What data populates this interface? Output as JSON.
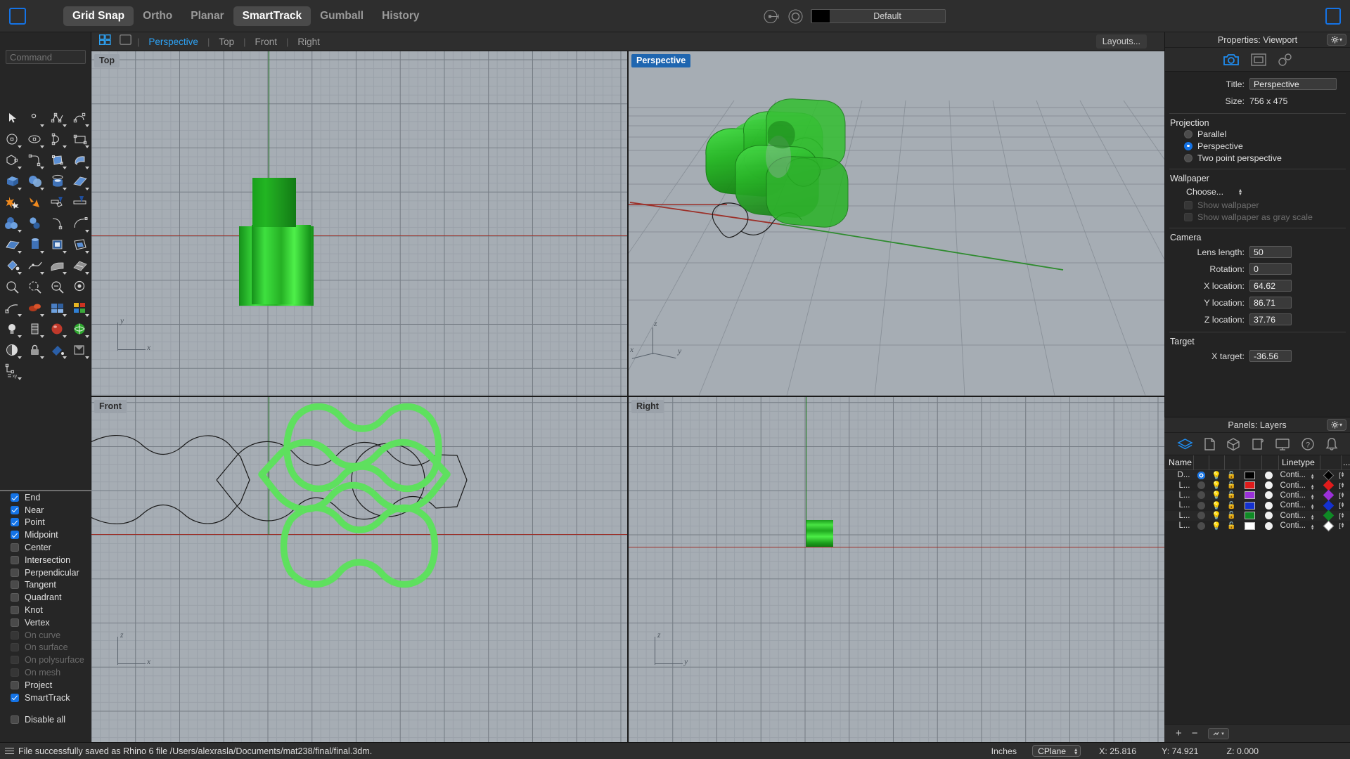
{
  "app": {
    "menu_items": [
      {
        "label": "Grid Snap",
        "active": true
      },
      {
        "label": "Ortho",
        "active": false
      },
      {
        "label": "Planar",
        "active": false
      },
      {
        "label": "SmartTrack",
        "active": true
      },
      {
        "label": "Gumball",
        "active": false
      },
      {
        "label": "History",
        "active": false
      }
    ],
    "current_layer_label": "Default",
    "current_layer_color": "#000000"
  },
  "command": {
    "placeholder": "Command",
    "value": ""
  },
  "viewport_tabs": {
    "names": [
      {
        "label": "Perspective",
        "active": true
      },
      {
        "label": "Top",
        "active": false
      },
      {
        "label": "Front",
        "active": false
      },
      {
        "label": "Right",
        "active": false
      }
    ],
    "layouts_label": "Layouts..."
  },
  "viewports": [
    {
      "name": "Top",
      "selected": false
    },
    {
      "name": "Perspective",
      "selected": true
    },
    {
      "name": "Front",
      "selected": false
    },
    {
      "name": "Right",
      "selected": false
    }
  ],
  "osnap": {
    "items": [
      {
        "label": "End",
        "checked": true,
        "disabled": false
      },
      {
        "label": "Near",
        "checked": true,
        "disabled": false
      },
      {
        "label": "Point",
        "checked": true,
        "disabled": false
      },
      {
        "label": "Midpoint",
        "checked": true,
        "disabled": false
      },
      {
        "label": "Center",
        "checked": false,
        "disabled": false
      },
      {
        "label": "Intersection",
        "checked": false,
        "disabled": false
      },
      {
        "label": "Perpendicular",
        "checked": false,
        "disabled": false
      },
      {
        "label": "Tangent",
        "checked": false,
        "disabled": false
      },
      {
        "label": "Quadrant",
        "checked": false,
        "disabled": false
      },
      {
        "label": "Knot",
        "checked": false,
        "disabled": false
      },
      {
        "label": "Vertex",
        "checked": false,
        "disabled": false
      },
      {
        "label": "On curve",
        "checked": false,
        "disabled": true
      },
      {
        "label": "On surface",
        "checked": false,
        "disabled": true
      },
      {
        "label": "On polysurface",
        "checked": false,
        "disabled": true
      },
      {
        "label": "On mesh",
        "checked": false,
        "disabled": true
      },
      {
        "label": "Project",
        "checked": false,
        "disabled": false
      },
      {
        "label": "SmartTrack",
        "checked": true,
        "disabled": false
      }
    ],
    "disable_all": {
      "label": "Disable all",
      "checked": false
    }
  },
  "properties": {
    "header": "Properties: Viewport",
    "tabs": [
      "camera-icon",
      "viewport-frame-icon",
      "links-icon"
    ],
    "title_label": "Title:",
    "title_value": "Perspective",
    "size_label": "Size:",
    "size_value": "756 x 475",
    "projection": {
      "title": "Projection",
      "options": [
        {
          "label": "Parallel",
          "selected": false
        },
        {
          "label": "Perspective",
          "selected": true
        },
        {
          "label": "Two point perspective",
          "selected": false
        }
      ]
    },
    "wallpaper": {
      "title": "Wallpaper",
      "choose_label": "Choose...",
      "show_wallpaper": {
        "label": "Show wallpaper",
        "checked": false,
        "disabled": true
      },
      "show_gray": {
        "label": "Show wallpaper as gray scale",
        "checked": false,
        "disabled": true
      }
    },
    "camera": {
      "title": "Camera",
      "fields": [
        {
          "label": "Lens length:",
          "value": "50"
        },
        {
          "label": "Rotation:",
          "value": "0"
        },
        {
          "label": "X location:",
          "value": "64.62"
        },
        {
          "label": "Y location:",
          "value": "86.71"
        },
        {
          "label": "Z location:",
          "value": "37.76"
        }
      ]
    },
    "target": {
      "title": "Target",
      "fields": [
        {
          "label": "X target:",
          "value": "-36.56"
        }
      ]
    }
  },
  "layers": {
    "header": "Panels: Layers",
    "tabs": [
      "layers-icon",
      "document-icon",
      "object-icon",
      "render-icon",
      "display-icon",
      "help-icon",
      "notifications-icon"
    ],
    "columns": [
      "Name",
      "",
      "",
      "",
      "",
      "",
      "Linetype",
      "",
      "..."
    ],
    "rows": [
      {
        "name": "D...",
        "on": true,
        "color": "#000000",
        "linetype": "Conti...",
        "print_color": "#000000"
      },
      {
        "name": "L...",
        "on": false,
        "color": "#e01b1b",
        "linetype": "Conti...",
        "print_color": "#e01b1b"
      },
      {
        "name": "L...",
        "on": false,
        "color": "#9b30d9",
        "linetype": "Conti...",
        "print_color": "#9b30d9"
      },
      {
        "name": "L...",
        "on": false,
        "color": "#1431cf",
        "linetype": "Conti...",
        "print_color": "#1431cf"
      },
      {
        "name": "L...",
        "on": false,
        "color": "#0f8a25",
        "linetype": "Conti...",
        "print_color": "#0f8a25"
      },
      {
        "name": "L...",
        "on": false,
        "color": "#ffffff",
        "linetype": "Conti...",
        "print_color": "#ffffff"
      }
    ]
  },
  "statusbar": {
    "message": "File successfully saved as Rhino 6 file /Users/alexrasla/Documents/mat238/final/final.3dm.",
    "units": "Inches",
    "cplane": "CPlane",
    "x": "X: 25.816",
    "y": "Y: 74.921",
    "z": "Z: 0.000"
  }
}
